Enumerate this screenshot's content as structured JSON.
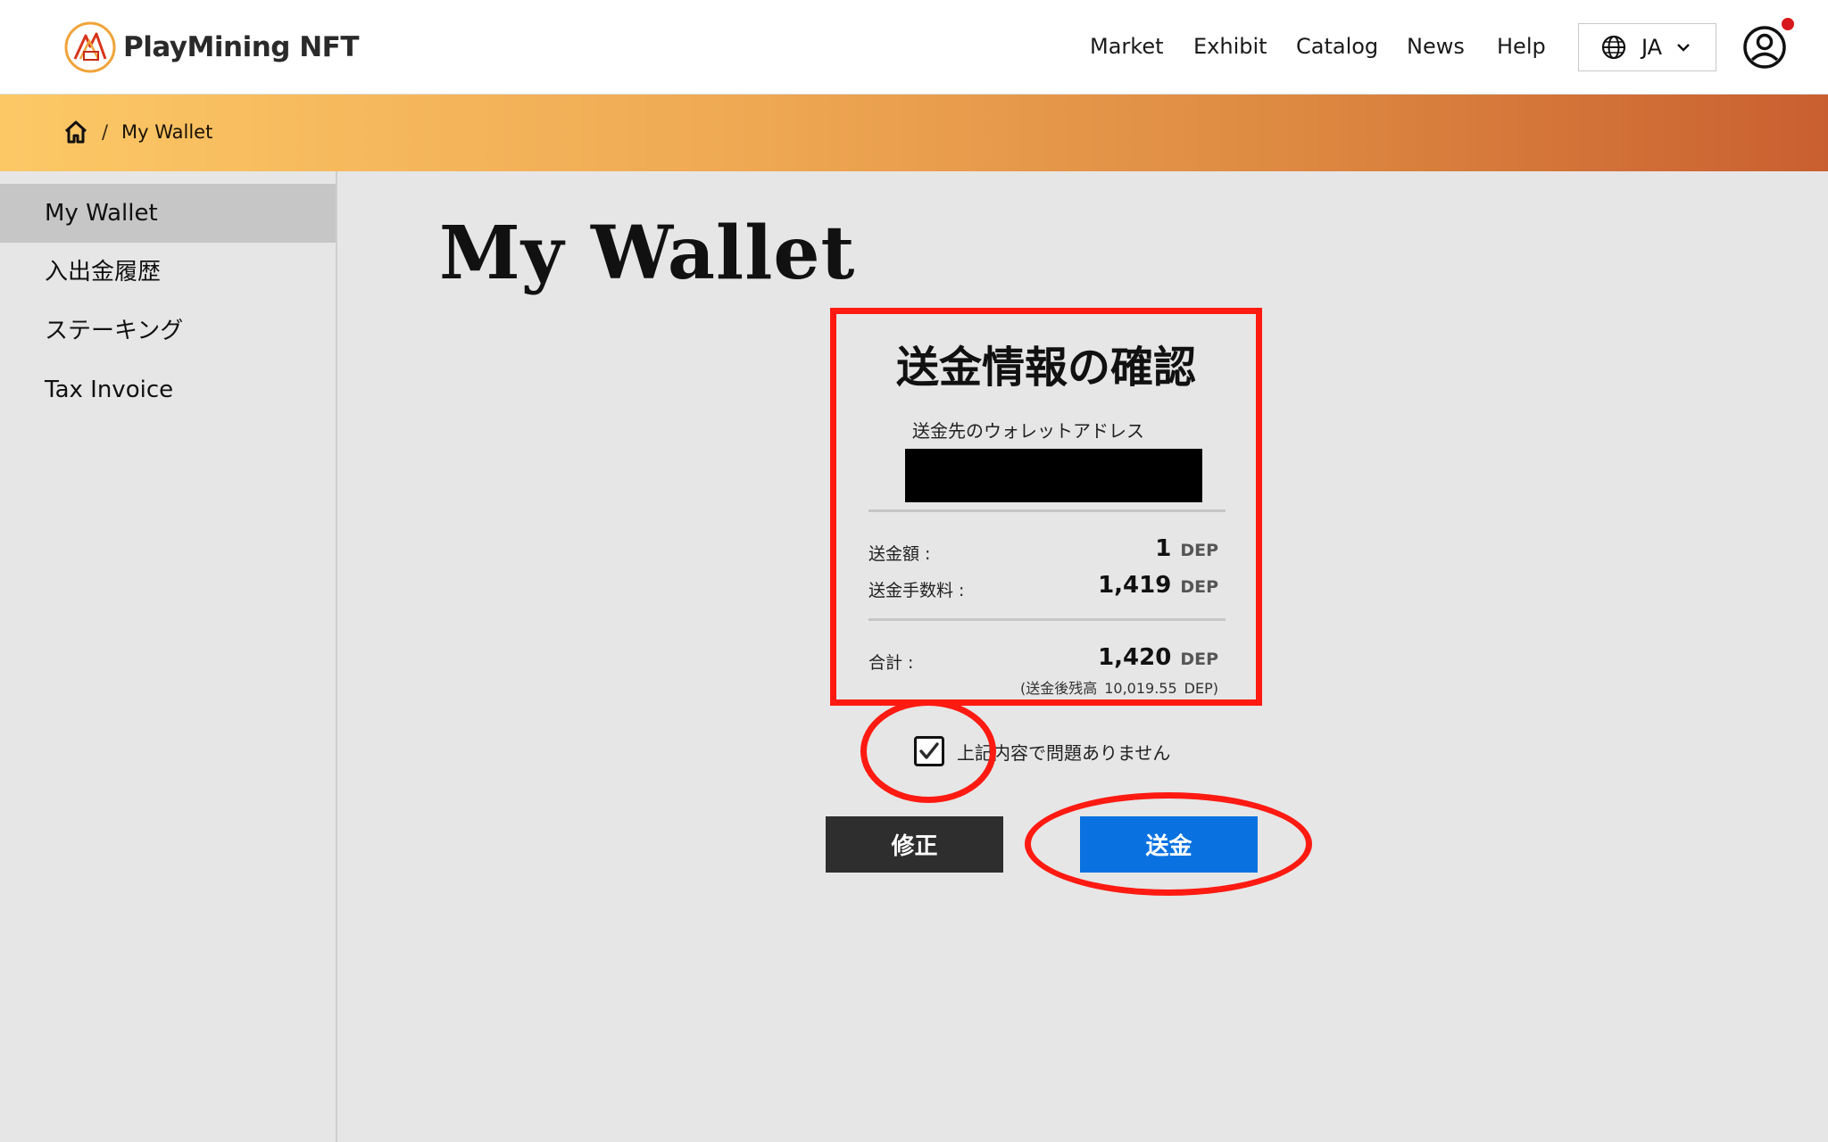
{
  "header": {
    "logo_text": "PlayMining NFT",
    "nav": [
      "Market",
      "Exhibit",
      "Catalog",
      "News",
      "Help"
    ],
    "language": "JA"
  },
  "breadcrumb": {
    "separator": "/",
    "current": "My Wallet"
  },
  "sidebar": {
    "items": [
      "My Wallet",
      "入出金履歴",
      "ステーキング",
      "Tax Invoice"
    ],
    "active": "My Wallet"
  },
  "main": {
    "page_title": "My Wallet",
    "confirm": {
      "title": "送金情報の確認",
      "address_label": "送金先のウォレットアドレス",
      "amount_label": "送金額 :",
      "amount_value": "1",
      "fee_label": "送金手数料 :",
      "fee_value": "1,419",
      "total_label": "合計 :",
      "total_value": "1,420",
      "unit": "DEP",
      "balance_prefix": "(送金後残高",
      "balance_value": "10,019.55",
      "balance_suffix": "DEP)"
    },
    "agree_text": "上記内容で問題ありません",
    "agree_checked": true,
    "edit_button": "修正",
    "send_button": "送金"
  },
  "colors": {
    "accent_blue": "#0a72e0",
    "annotation_red": "#ff1a12",
    "band_start": "#fcc866",
    "band_end": "#c95f30",
    "notify_dot": "#d8171c"
  }
}
